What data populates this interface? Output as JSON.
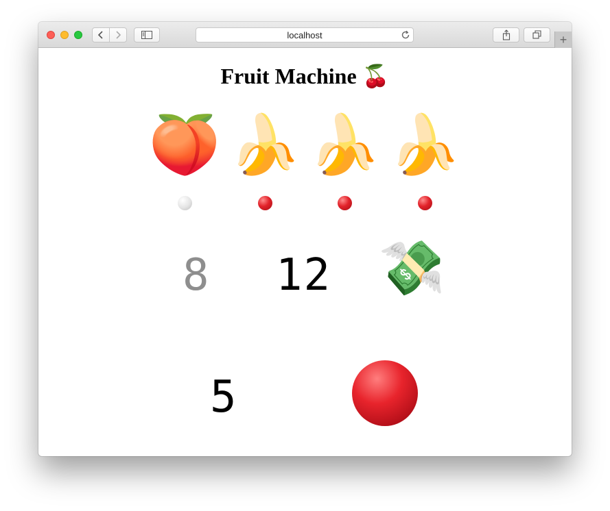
{
  "browser": {
    "address": "localhost"
  },
  "page": {
    "title": "Fruit Machine",
    "title_emoji": "🍒"
  },
  "reels": [
    {
      "symbol": "🍑",
      "name": "peach",
      "held": false
    },
    {
      "symbol": "🍌",
      "name": "banana",
      "held": true
    },
    {
      "symbol": "🍌",
      "name": "banana",
      "held": true
    },
    {
      "symbol": "🍌",
      "name": "banana",
      "held": true
    }
  ],
  "stats": {
    "left_number": "8",
    "middle_number": "12",
    "money_symbol": "💸",
    "bottom_number": "5"
  },
  "colors": {
    "light_on": "#e2222a",
    "light_off": "#e4e4e4",
    "button": "#e8242c",
    "dim_number": "#8e8e8e"
  }
}
